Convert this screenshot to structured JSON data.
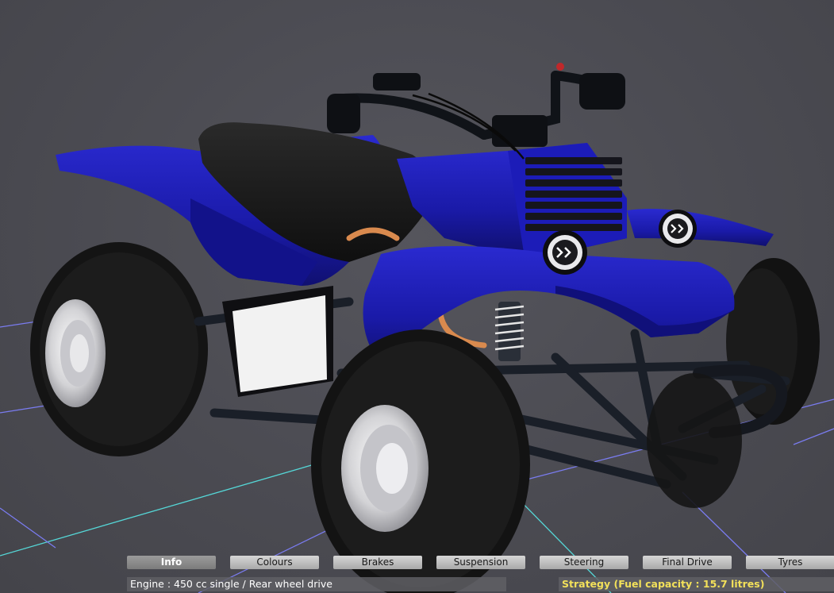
{
  "tabs": [
    {
      "label": "Info",
      "active": true
    },
    {
      "label": "Colours",
      "active": false
    },
    {
      "label": "Brakes",
      "active": false
    },
    {
      "label": "Suspension",
      "active": false
    },
    {
      "label": "Steering",
      "active": false
    },
    {
      "label": "Final Drive",
      "active": false
    },
    {
      "label": "Tyres",
      "active": false
    }
  ],
  "info": {
    "engine": "Engine : 450 cc single / Rear wheel drive",
    "strategy": "Strategy (Fuel capacity : 15.7 litres)"
  },
  "colors": {
    "body": "#1a1aa8",
    "tyre": "#161616",
    "rim": "#cfcfd2",
    "background": "#4a4a50",
    "strategy_text": "#f2e05a"
  },
  "model": {
    "name_icon": "atv-quad-bike-3d-model"
  }
}
